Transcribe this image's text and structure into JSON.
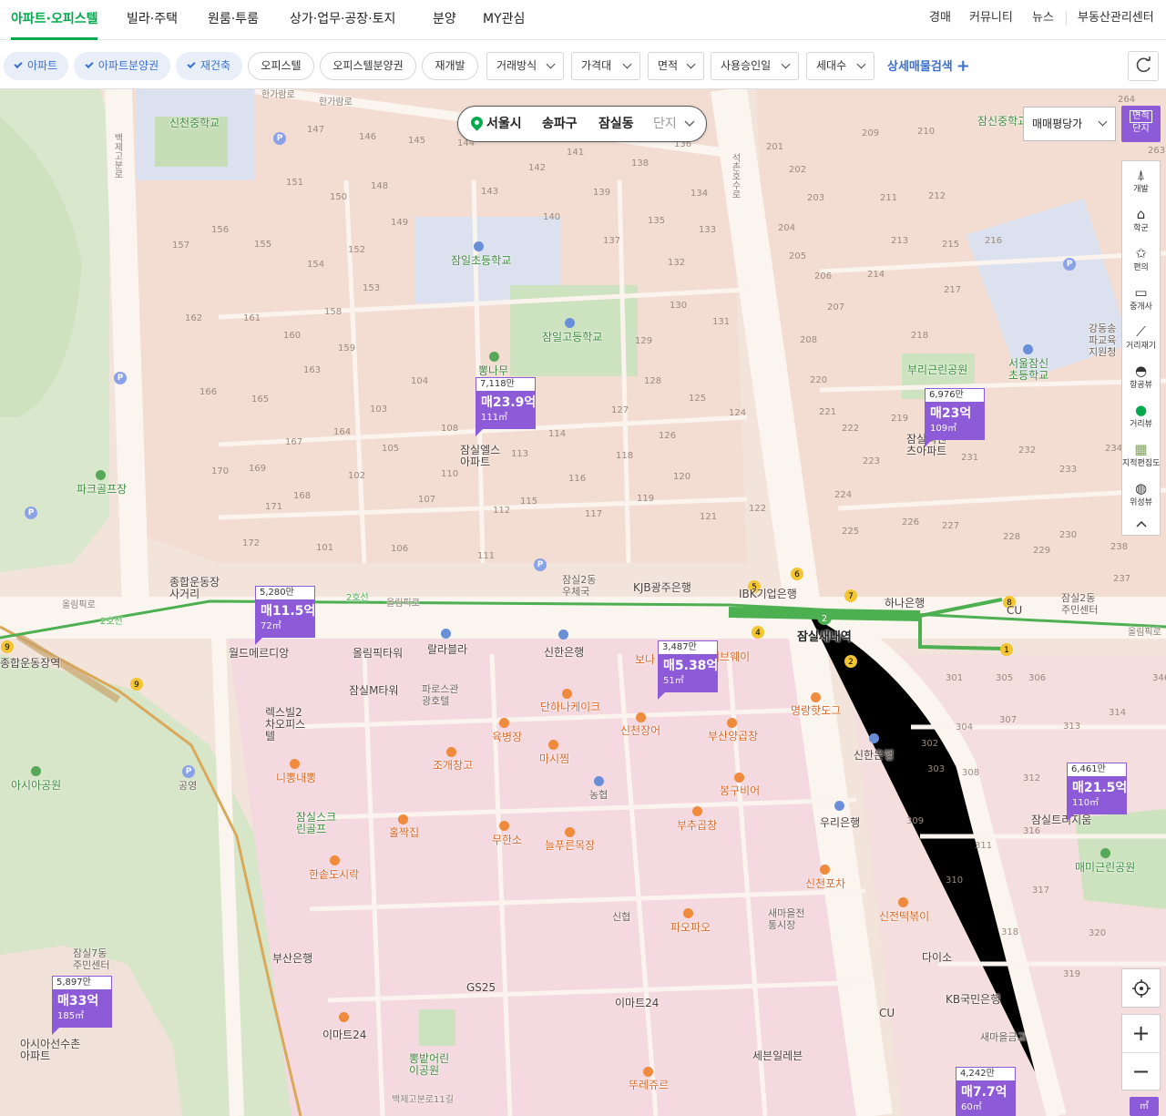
{
  "nav": {
    "tabs": [
      "아파트·오피스텔",
      "빌라·주택",
      "원룸·투룸",
      "상가·업무·공장·토지",
      "분양",
      "MY관심"
    ],
    "right_links": [
      "경매",
      "커뮤니티",
      "뉴스",
      "부동산관리센터"
    ]
  },
  "filters": {
    "chips_on": [
      "아파트",
      "아파트분양권",
      "재건축"
    ],
    "chips_off": [
      "오피스텔",
      "오피스텔분양권",
      "재개발"
    ],
    "dropdowns": [
      "거래방식",
      "가격대",
      "면적",
      "사용승인일",
      "세대수"
    ],
    "detail_search": "상세매물검색"
  },
  "breadcrumb": {
    "city": "서울시",
    "district": "송파구",
    "dong": "잠실동",
    "complex": "단지"
  },
  "price_mode": "매매평당가",
  "area_toggle": [
    "면적",
    "단지"
  ],
  "toolbar": [
    "개발",
    "학군",
    "편의",
    "중개사",
    "거리재기",
    "항공뷰",
    "거리뷰",
    "지적편집도",
    "위성뷰"
  ],
  "unit_toggle": "㎡",
  "colors": {
    "brand": "#03a94d",
    "marker": "#8e5bd8",
    "link": "#3b6fcf",
    "line2": "#4caf50"
  },
  "markers": [
    {
      "count": "7,118만",
      "price": "매23.9억",
      "area": "111㎡"
    },
    {
      "count": "6,976만",
      "price": "매23억",
      "area": "109㎡"
    },
    {
      "count": "5,280만",
      "price": "매11.5억",
      "area": "72㎡"
    },
    {
      "count": "3,487만",
      "price": "매5.38억",
      "area": "51㎡"
    },
    {
      "count": "6,461만",
      "price": "매21.5억",
      "area": "110㎡"
    },
    {
      "count": "5,897만",
      "price": "매33억",
      "area": "185㎡"
    },
    {
      "count": "4,242만",
      "price": "매7.7억",
      "area": "60㎡"
    }
  ],
  "places": {
    "school1": "신천중학교",
    "school2": "잠일초등학교",
    "school3": "잠일고등학교",
    "school4": "잠신중학교",
    "school5": "서울잠신초등학교",
    "school6": "강동송파교육지원청",
    "park1": "파크골프장",
    "park2": "부리근린공원",
    "park3": "뽕나무",
    "park4": "아시아공원",
    "park5": "잠실스크린골프",
    "park6": "매미근린공원",
    "park7": "뽕밭어린이공원",
    "apt1": "잠실엘스아파트",
    "apt2": "잠실리센츠아파트",
    "apt3": "아시아선수촌아파트",
    "apt4": "잠실트리지움",
    "station": "잠실새내역",
    "stadium": "종합운동장역",
    "crossing": "종합운동장사거리",
    "bank1": "KJB광주은행",
    "bank2": "IBK기업은행",
    "bank3": "신한은행",
    "bank4": "하나은행",
    "bank5": "우리은행",
    "bank6": "신한은행",
    "bank7": "부산은행",
    "bank8": "KB국민은행",
    "bank9": "새마을금고",
    "office1": "잠실2동우체국",
    "office2": "잠실2동주민센터",
    "office3": "잠실7동주민센터",
    "bldg1": "월드메르디앙",
    "bldg2": "올림픽타워",
    "bldg3": "랄라블라",
    "bldg4": "잠실M타워",
    "bldg5": "파로스관광호텔",
    "bldg6": "렉스빌2차오피스텔",
    "bldg7": "공영",
    "market": "새마을전통시장",
    "food1": "단하나케이크",
    "food2": "육병장",
    "food3": "마시찜",
    "food4": "조개창고",
    "food5": "신천장어",
    "food6": "부산양곱창",
    "food7": "봉구비어",
    "food8": "부추곱창",
    "food9": "니뽕내뽕",
    "food10": "홀짝집",
    "food11": "무한소",
    "food12": "늘푸른목장",
    "food13": "한솥도시락",
    "food14": "파오파오",
    "food15": "신천포차",
    "food16": "신전떡볶이",
    "food17": "명랑핫도그",
    "food18": "써브웨이",
    "food19": "보나",
    "food20": "뚜레쥬르",
    "store1": "GS25",
    "store2": "이마트24",
    "store3": "이마트24",
    "store4": "세븐일레븐",
    "store5": "CU",
    "store6": "CU",
    "store7": "다이소",
    "store8": "신협",
    "store9": "농협",
    "road1": "한가람로",
    "road2": "한가람로",
    "road3": "올림픽로",
    "road4": "올림픽로",
    "road5": "올림픽로",
    "road6": "백제고분로",
    "road7": "석촌호수로",
    "road8": "2호선",
    "road9": "2호선",
    "road10": "백제고분로11길"
  },
  "blocks": [
    "147",
    "146",
    "145",
    "144",
    "143",
    "142",
    "141",
    "138",
    "136",
    "134",
    "133",
    "135",
    "137",
    "140",
    "139",
    "151",
    "150",
    "148",
    "149",
    "155",
    "152",
    "153",
    "154",
    "156",
    "157",
    "158",
    "159",
    "160",
    "161",
    "162",
    "163",
    "164",
    "165",
    "166",
    "167",
    "168",
    "169",
    "170",
    "171",
    "172",
    "101",
    "102",
    "103",
    "104",
    "105",
    "106",
    "107",
    "108",
    "110",
    "111",
    "112",
    "113",
    "114",
    "115",
    "116",
    "117",
    "118",
    "119",
    "120",
    "121",
    "122",
    "124",
    "125",
    "126",
    "127",
    "128",
    "129",
    "130",
    "131",
    "132",
    "201",
    "202",
    "203",
    "204",
    "205",
    "206",
    "207",
    "208",
    "209",
    "210",
    "211",
    "212",
    "213",
    "214",
    "215",
    "216",
    "217",
    "218",
    "219",
    "220",
    "221",
    "222",
    "223",
    "224",
    "225",
    "226",
    "227",
    "228",
    "229",
    "230",
    "231",
    "232",
    "233",
    "234",
    "237",
    "238",
    "263",
    "264",
    "301",
    "302",
    "303",
    "304",
    "305",
    "306",
    "307",
    "308",
    "309",
    "310",
    "311",
    "312",
    "313",
    "314",
    "316",
    "317",
    "318",
    "319",
    "320",
    "346"
  ]
}
